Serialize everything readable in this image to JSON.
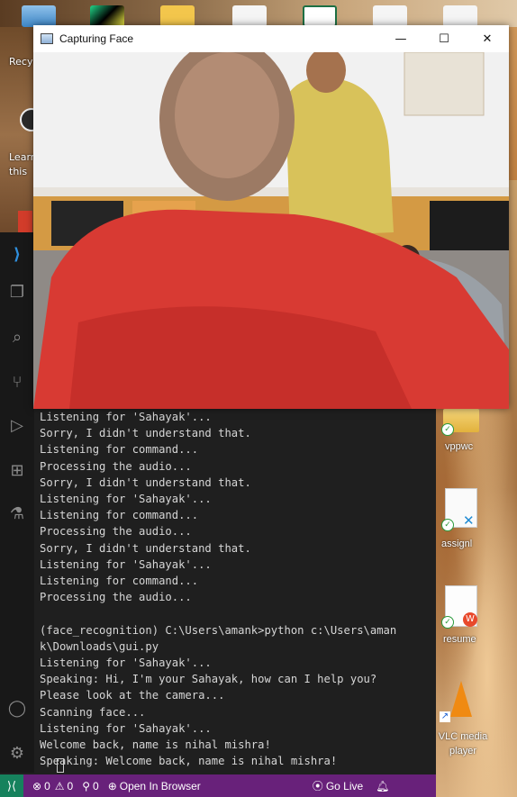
{
  "camera_window": {
    "title": "Capturing Face",
    "minimize_glyph": "—",
    "maximize_glyph": "☐",
    "close_glyph": "✕"
  },
  "desktop": {
    "left_labels": [
      "Recy",
      "Learn",
      "this"
    ],
    "right_icons": [
      {
        "label": "vppwc",
        "icon": "folder-icon"
      },
      {
        "label": "assignl",
        "icon": "vscode-file-icon"
      },
      {
        "label": "resume",
        "icon": "wps-document-icon"
      },
      {
        "label": "VLC media player",
        "icon": "vlc-icon"
      }
    ]
  },
  "terminal": {
    "lines": [
      "Listening for 'Sahayak'...",
      "Sorry, I didn't understand that.",
      "Listening for command...",
      "Processing the audio...",
      "Sorry, I didn't understand that.",
      "Listening for 'Sahayak'...",
      "Listening for command...",
      "Processing the audio...",
      "Sorry, I didn't understand that.",
      "Listening for 'Sahayak'...",
      "Listening for command...",
      "Processing the audio...",
      "",
      "(face_recognition) C:\\Users\\amank>python c:\\Users\\aman",
      "k\\Downloads\\gui.py",
      "Listening for 'Sahayak'...",
      "Speaking: Hi, I'm your Sahayak, how can I help you?",
      "Please look at the camera...",
      "Scanning face...",
      "Listening for 'Sahayak'...",
      "Welcome back, name is nihal mishra!",
      "Speaking: Welcome back, name is nihal mishra!"
    ]
  },
  "statusbar": {
    "errors": "0",
    "warnings": "0",
    "ports": "0",
    "open_browser": "Open In Browser",
    "go_live": "Go Live"
  },
  "colors": {
    "statusbar": "#68217a",
    "remote": "#16825d",
    "terminal_bg": "#1f1f1f"
  }
}
